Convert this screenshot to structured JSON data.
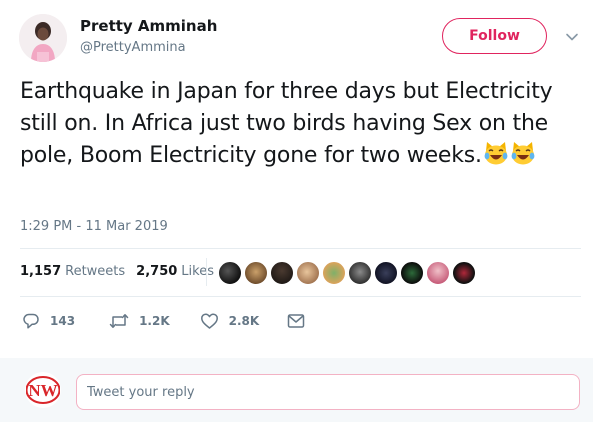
{
  "author": {
    "name": "Pretty Amminah",
    "handle": "@PrettyAmmina",
    "avatar_icon": "profile-photo"
  },
  "follow_button": {
    "label": "Follow",
    "color": "#e0245e"
  },
  "tweet": {
    "text": "Earthquake in Japan for three days but Electricity still on. In Africa just two birds having Sex on the pole, Boom Electricity gone for two weeks.",
    "emoji": [
      "face-with-tears-of-joy-cat",
      "face-with-tears-of-joy-cat"
    ],
    "timestamp": "1:29 PM - 11 Mar 2019"
  },
  "stats": {
    "retweets_count": "1,157",
    "retweets_label": "Retweets",
    "likes_count": "2,750",
    "likes_label": "Likes",
    "liker_avatar_count": 10
  },
  "actions": {
    "reply_count": "143",
    "retweet_count": "1.2K",
    "like_count": "2.8K"
  },
  "reply": {
    "placeholder": "Tweet your reply",
    "avatar_text": "NW"
  },
  "colors": {
    "text": "#14171a",
    "muted": "#657786",
    "accent": "#e0245e",
    "divider": "#e6ecf0",
    "reply_bg": "#f5f8fa"
  }
}
